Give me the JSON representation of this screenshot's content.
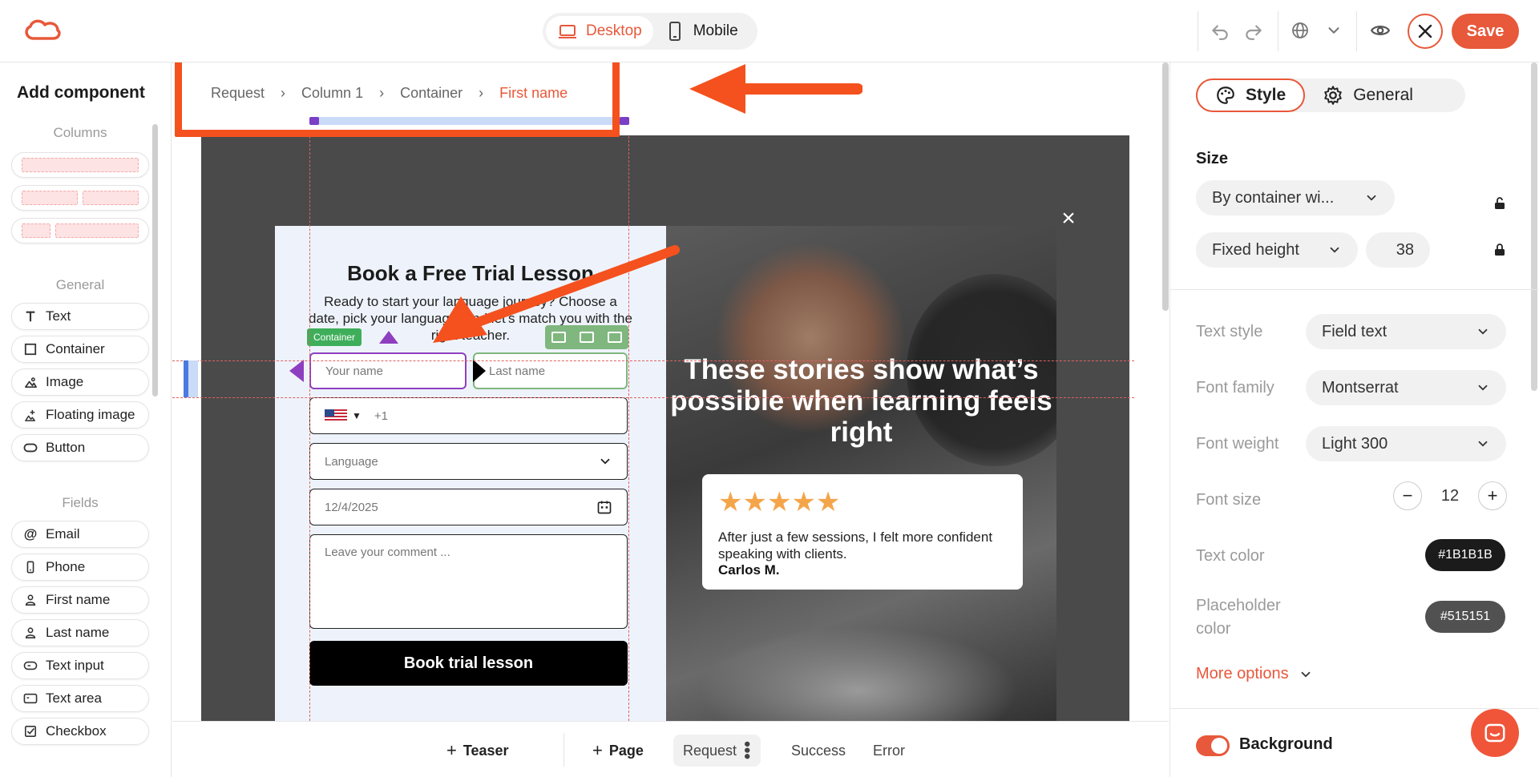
{
  "topbar": {
    "view_desktop": "Desktop",
    "view_mobile": "Mobile",
    "save_label": "Save"
  },
  "sidebar": {
    "title": "Add component",
    "columns_label": "Columns",
    "general_label": "General",
    "fields_label": "Fields",
    "general_items": [
      {
        "label": "Text",
        "icon": "text-icon"
      },
      {
        "label": "Container",
        "icon": "container-icon"
      },
      {
        "label": "Image",
        "icon": "image-icon"
      },
      {
        "label": "Floating image",
        "icon": "floating-image-icon"
      },
      {
        "label": "Button",
        "icon": "button-icon"
      }
    ],
    "field_items": [
      {
        "label": "Email",
        "icon": "at-icon"
      },
      {
        "label": "Phone",
        "icon": "phone-icon"
      },
      {
        "label": "First name",
        "icon": "person-icon"
      },
      {
        "label": "Last name",
        "icon": "person-icon"
      },
      {
        "label": "Text input",
        "icon": "text-input-icon"
      },
      {
        "label": "Text area",
        "icon": "text-area-icon"
      },
      {
        "label": "Checkbox",
        "icon": "checkbox-icon"
      }
    ]
  },
  "breadcrumb": {
    "items": [
      "Request",
      "Column 1",
      "Container",
      "First name"
    ],
    "separator": "›"
  },
  "popup": {
    "title": "Book a Free Trial Lesson",
    "subtitle": "Ready to start your language journey? Choose a date, pick your language, and let's match you with the right teacher.",
    "container_tag": "Container",
    "first_name_placeholder": "Your name",
    "last_name_placeholder": "Last name",
    "phone_prefix": "+1",
    "language_placeholder": "Language",
    "date_value": "12/4/2025",
    "comment_placeholder": "Leave your comment ...",
    "cta_label": "Book trial lesson",
    "close_symbol": "×",
    "hero_text": "These stories show what’s possible when learning feels right",
    "review_stars": "★★★★★",
    "review_text": "After just a few sessions, I felt more confident speaking with clients.",
    "review_author": "Carlos M."
  },
  "bottom_bar": {
    "teaser": "Teaser",
    "page": "Page",
    "request": "Request",
    "success": "Success",
    "error": "Error"
  },
  "right_panel": {
    "tab_style": "Style",
    "tab_general": "General",
    "size_label": "Size",
    "width_mode": "By container wi...",
    "height_mode": "Fixed height",
    "height_value": "38",
    "text_style_label": "Text style",
    "text_style_value": "Field text",
    "font_family_label": "Font family",
    "font_family_value": "Montserrat",
    "font_weight_label": "Font weight",
    "font_weight_value": "Light 300",
    "font_size_label": "Font size",
    "font_size_value": "12",
    "text_color_label": "Text color",
    "text_color_value": "#1B1B1B",
    "placeholder_color_label": "Placeholder color",
    "placeholder_color_value": "#515151",
    "more_options": "More options",
    "background_label": "Background"
  },
  "colors": {
    "accent": "#e8583a",
    "annotation_red": "#f4511e",
    "selection_purple": "#8e3fbf",
    "container_green": "#3fae5b"
  }
}
